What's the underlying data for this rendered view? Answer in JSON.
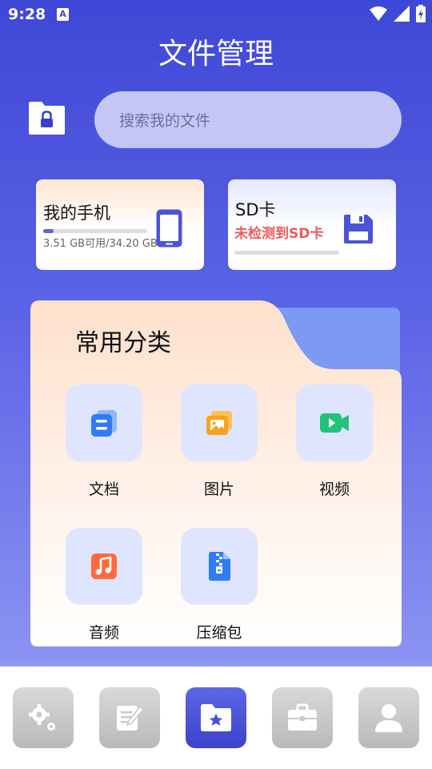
{
  "status_bar": {
    "time": "9:28",
    "notification_glyph": "A"
  },
  "header": {
    "title": "文件管理"
  },
  "search": {
    "placeholder": "搜索我的文件"
  },
  "storage": {
    "phone": {
      "name": "我的手机",
      "usage": "3.51 GB可用/34.20 GB",
      "used_fraction": 0.1
    },
    "sd": {
      "name": "SD卡",
      "status": "未检测到SD卡"
    }
  },
  "categories": {
    "title": "常用分类",
    "items": [
      {
        "label": "文档",
        "icon": "document-icon"
      },
      {
        "label": "图片",
        "icon": "image-icon"
      },
      {
        "label": "视频",
        "icon": "video-icon"
      },
      {
        "label": "音频",
        "icon": "audio-icon"
      },
      {
        "label": "压缩包",
        "icon": "archive-icon"
      }
    ]
  },
  "bottom_tabs": [
    {
      "icon": "settings-icon"
    },
    {
      "icon": "notes-icon"
    },
    {
      "icon": "files-icon",
      "active": true
    },
    {
      "icon": "toolbox-icon"
    },
    {
      "icon": "profile-icon"
    }
  ],
  "colors": {
    "accent": "#4a52d8",
    "sd_warning": "#f05a5a"
  }
}
